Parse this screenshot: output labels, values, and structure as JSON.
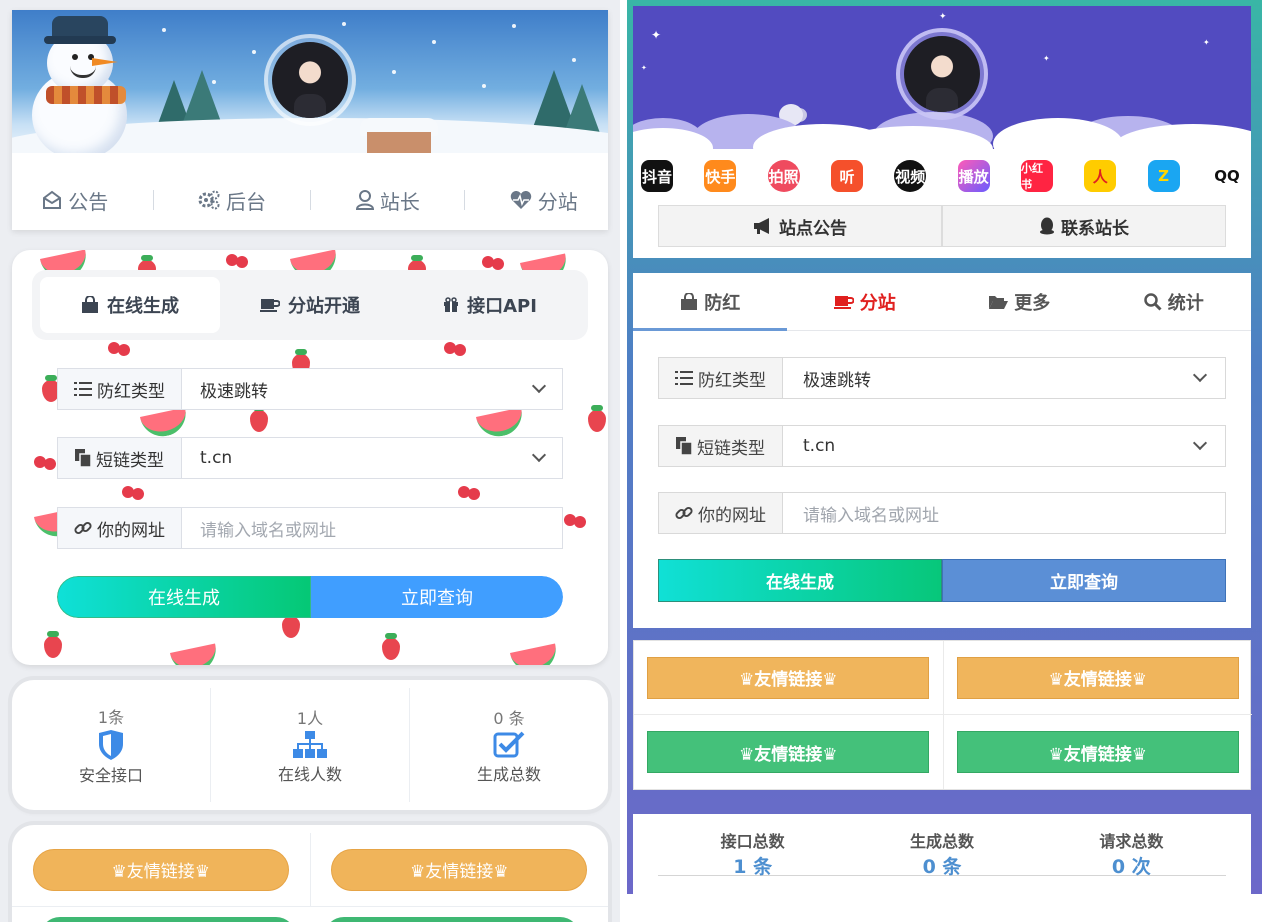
{
  "left": {
    "nav": [
      {
        "label": "公告",
        "icon": "envelope-open-icon"
      },
      {
        "label": "后台",
        "icon": "gears-icon"
      },
      {
        "label": "站长",
        "icon": "user-icon"
      },
      {
        "label": "分站",
        "icon": "heartbeat-icon"
      }
    ],
    "tabs": [
      {
        "label": "在线生成",
        "icon": "shopping-bag-icon"
      },
      {
        "label": "分站开通",
        "icon": "coffee-icon"
      },
      {
        "label": "接口API",
        "icon": "gift-icon"
      }
    ],
    "form": {
      "type_label": "防红类型",
      "type_value": "极速跳转",
      "short_label": "短链类型",
      "short_value": "t.cn",
      "url_label": "你的网址",
      "url_placeholder": "请输入域名或网址"
    },
    "buttons": {
      "generate": "在线生成",
      "query": "立即查询"
    },
    "stats": [
      {
        "num": "1条",
        "label": "安全接口",
        "icon": "shield-icon"
      },
      {
        "num": "1人",
        "label": "在线人数",
        "icon": "sitemap-icon"
      },
      {
        "num": "0 条",
        "label": "生成总数",
        "icon": "check-square-icon"
      }
    ],
    "friends": [
      "♛友情链接♛",
      "♛友情链接♛"
    ]
  },
  "right": {
    "apps": [
      "抖音",
      "快手",
      "拍照",
      "听",
      "视频",
      "播放",
      "小红书",
      "人",
      "Z",
      "QQ"
    ],
    "top_buttons": {
      "notice": "站点公告",
      "contact": "联系站长"
    },
    "tabs": [
      {
        "label": "防红",
        "icon": "shopping-bag-icon"
      },
      {
        "label": "分站",
        "icon": "coffee-icon"
      },
      {
        "label": "更多",
        "icon": "folder-open-icon"
      },
      {
        "label": "统计",
        "icon": "search-icon"
      }
    ],
    "form": {
      "type_label": "防红类型",
      "type_value": "极速跳转",
      "short_label": "短链类型",
      "short_value": "t.cn",
      "url_label": "你的网址",
      "url_placeholder": "请输入域名或网址"
    },
    "buttons": {
      "generate": "在线生成",
      "query": "立即查询"
    },
    "friends": [
      "♛友情链接♛",
      "♛友情链接♛",
      "♛友情链接♛",
      "♛友情链接♛"
    ],
    "stats": [
      {
        "label": "接口总数",
        "value": "1 条"
      },
      {
        "label": "生成总数",
        "value": "0 条"
      },
      {
        "label": "请求总数",
        "value": "0 次"
      }
    ]
  },
  "colors": {
    "accent_blue": "#409eff",
    "gradient_green_start": "#0fe0d8",
    "gradient_green_end": "#05c875",
    "friend_orange": "#f0b45a",
    "friend_green": "#44c17a",
    "active_tab_red": "#e0201f",
    "stat_blue": "#4d8fd0",
    "right_banner": "#524bc0"
  }
}
